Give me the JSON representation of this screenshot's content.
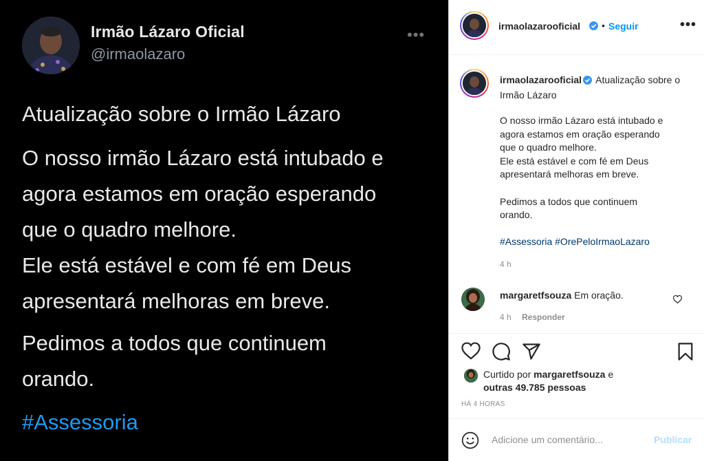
{
  "tweet": {
    "name": "Irmão Lázaro Oficial",
    "handle": "@irmaolazaro",
    "more": "•••",
    "title": "Atualização sobre o Irmão Lázaro",
    "para1": [
      "O nosso irmão Lázaro está intubado e",
      "agora estamos em oração esperando",
      "que o quadro melhore.",
      "Ele está estável e com fé em Deus",
      "apresentará melhoras em breve."
    ],
    "para2": [
      "Pedimos a todos que continuem",
      "orando."
    ],
    "hashtag": "#Assessoria"
  },
  "instagram": {
    "header": {
      "username": "irmaolazarooficial",
      "separator": "•",
      "follow_label": "Seguir",
      "options": "•••"
    },
    "caption": {
      "username": "irmaolazarooficial",
      "title": "Atualização sobre o Irmão Lázaro",
      "lines": [
        "O nosso irmão Lázaro está intubado e",
        "agora estamos em oração esperando",
        "que o quadro melhore.",
        "Ele está estável e com fé em Deus",
        "apresentará melhoras em breve.",
        "",
        "Pedimos a todos que continuem",
        "orando."
      ],
      "hashtags": "#Assessoria #OrePeloIrmaoLazaro",
      "time": "4 h"
    },
    "comment": {
      "username": "margaretfsouza",
      "text": "Em oração.",
      "time": "4 h",
      "reply_label": "Responder"
    },
    "likes": {
      "prefix": "Curtido por",
      "user": "margaretfsouza",
      "conj": "e",
      "others": "outras 49.785 pessoas"
    },
    "time_ago": "HÁ 4 HORAS",
    "add_comment": {
      "placeholder": "Adicione um comentário...",
      "publish_label": "Publicar"
    },
    "colors": {
      "link": "#0095f6",
      "hashtag": "#00376b",
      "tweet_hashtag": "#1d9bf0",
      "verified": "#3897f0"
    }
  }
}
